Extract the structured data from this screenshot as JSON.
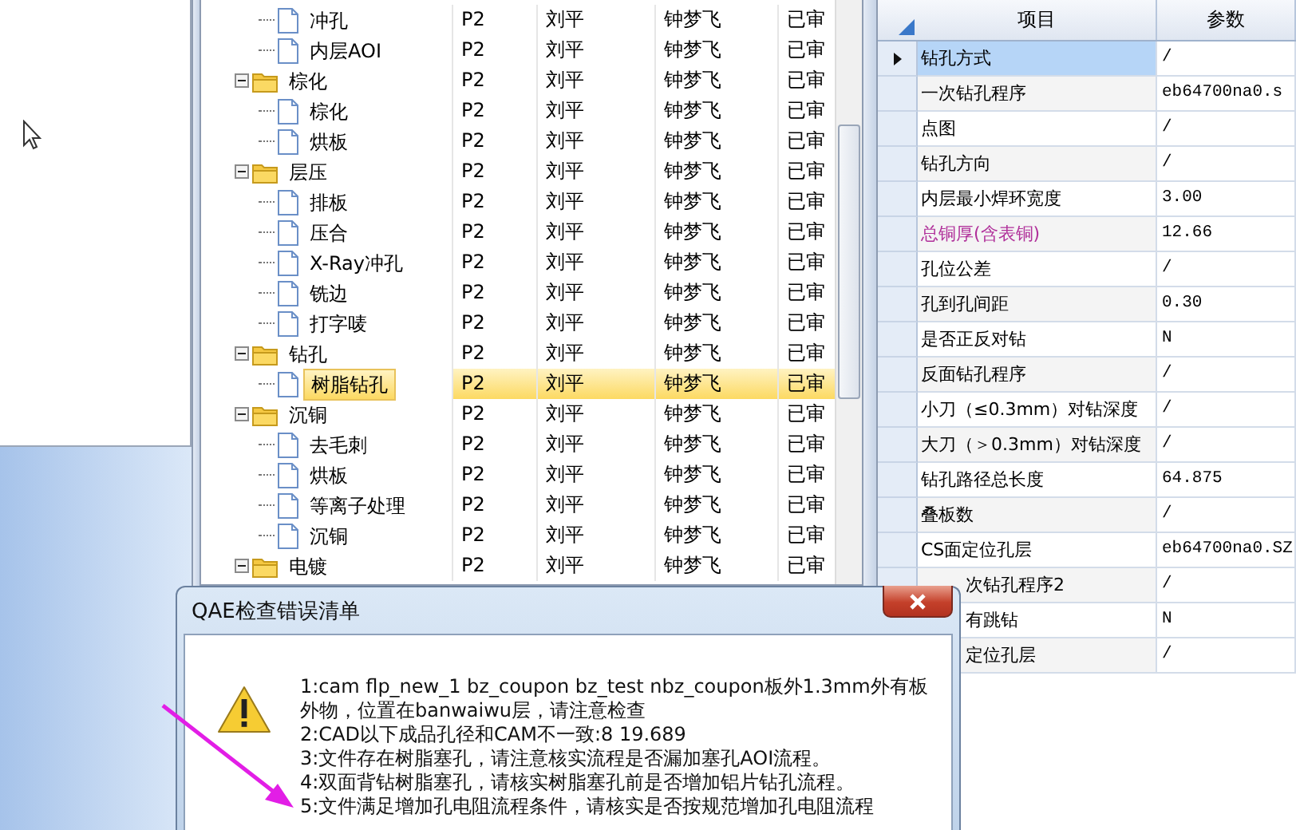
{
  "process_tree": {
    "items": [
      {
        "children": [
          {
            "kind": "file",
            "label": "冲孔",
            "selected": false,
            "cells": [
              "P2",
              "刘平",
              "钟梦飞",
              "已审"
            ]
          },
          {
            "kind": "file",
            "label": "内层AOI",
            "selected": false,
            "cells": [
              "P2",
              "刘平",
              "钟梦飞",
              "已审"
            ]
          }
        ]
      },
      {
        "kind": "folder",
        "label": "棕化",
        "expanded": true,
        "selected": false,
        "cells": [
          "P2",
          "刘平",
          "钟梦飞",
          "已审"
        ],
        "children": [
          {
            "kind": "file",
            "label": "棕化",
            "selected": false,
            "cells": [
              "P2",
              "刘平",
              "钟梦飞",
              "已审"
            ]
          },
          {
            "kind": "file",
            "label": "烘板",
            "selected": false,
            "cells": [
              "P2",
              "刘平",
              "钟梦飞",
              "已审"
            ]
          }
        ]
      },
      {
        "kind": "folder",
        "label": "层压",
        "expanded": true,
        "selected": false,
        "cells": [
          "P2",
          "刘平",
          "钟梦飞",
          "已审"
        ],
        "children": [
          {
            "kind": "file",
            "label": "排板",
            "selected": false,
            "cells": [
              "P2",
              "刘平",
              "钟梦飞",
              "已审"
            ]
          },
          {
            "kind": "file",
            "label": "压合",
            "selected": false,
            "cells": [
              "P2",
              "刘平",
              "钟梦飞",
              "已审"
            ]
          },
          {
            "kind": "file",
            "label": "X-Ray冲孔",
            "selected": false,
            "cells": [
              "P2",
              "刘平",
              "钟梦飞",
              "已审"
            ]
          },
          {
            "kind": "file",
            "label": "铣边",
            "selected": false,
            "cells": [
              "P2",
              "刘平",
              "钟梦飞",
              "已审"
            ]
          },
          {
            "kind": "file",
            "label": "打字唛",
            "selected": false,
            "cells": [
              "P2",
              "刘平",
              "钟梦飞",
              "已审"
            ]
          }
        ]
      },
      {
        "kind": "folder",
        "label": "钻孔",
        "expanded": true,
        "selected": false,
        "cells": [
          "P2",
          "刘平",
          "钟梦飞",
          "已审"
        ],
        "children": [
          {
            "kind": "file",
            "label": "树脂钻孔",
            "selected": true,
            "cells": [
              "P2",
              "刘平",
              "钟梦飞",
              "已审"
            ]
          }
        ]
      },
      {
        "kind": "folder",
        "label": "沉铜",
        "expanded": true,
        "selected": false,
        "cells": [
          "P2",
          "刘平",
          "钟梦飞",
          "已审"
        ],
        "children": [
          {
            "kind": "file",
            "label": "去毛刺",
            "selected": false,
            "cells": [
              "P2",
              "刘平",
              "钟梦飞",
              "已审"
            ]
          },
          {
            "kind": "file",
            "label": "烘板",
            "selected": false,
            "cells": [
              "P2",
              "刘平",
              "钟梦飞",
              "已审"
            ]
          },
          {
            "kind": "file",
            "label": "等离子处理",
            "selected": false,
            "cells": [
              "P2",
              "刘平",
              "钟梦飞",
              "已审"
            ]
          },
          {
            "kind": "file",
            "label": "沉铜",
            "selected": false,
            "cells": [
              "P2",
              "刘平",
              "钟梦飞",
              "已审"
            ]
          }
        ]
      },
      {
        "kind": "folder",
        "label": "电镀",
        "expanded": true,
        "selected": false,
        "cells": [
          "P2",
          "刘平",
          "钟梦飞",
          "已审"
        ]
      }
    ]
  },
  "property_grid": {
    "columns": [
      "项目",
      "参数"
    ],
    "rows": [
      {
        "item": "钻孔方式",
        "value": "/",
        "selected": true,
        "color": "#000000"
      },
      {
        "item": "一次钻孔程序",
        "value": "eb64700na0.s",
        "selected": false,
        "color": "#000000"
      },
      {
        "item": "点图",
        "value": "/",
        "selected": false,
        "color": "#000000"
      },
      {
        "item": "钻孔方向",
        "value": "/",
        "selected": false,
        "color": "#000000"
      },
      {
        "item": "内层最小焊环宽度",
        "value": "3.00",
        "selected": false,
        "color": "#000000"
      },
      {
        "item": "总铜厚(含表铜)",
        "value": "12.66",
        "selected": false,
        "color": "#b0309a"
      },
      {
        "item": "孔位公差",
        "value": "/",
        "selected": false,
        "color": "#000000"
      },
      {
        "item": "孔到孔间距",
        "value": "0.30",
        "selected": false,
        "color": "#000000"
      },
      {
        "item": "是否正反对钻",
        "value": "N",
        "selected": false,
        "color": "#000000"
      },
      {
        "item": "反面钻孔程序",
        "value": "/",
        "selected": false,
        "color": "#000000"
      },
      {
        "item": "小刀（≤0.3mm）对钻深度",
        "value": "/",
        "selected": false,
        "color": "#000000"
      },
      {
        "item": "大刀（＞0.3mm）对钻深度",
        "value": "/",
        "selected": false,
        "color": "#000000"
      },
      {
        "item": "钻孔路径总长度",
        "value": "64.875",
        "selected": false,
        "color": "#000000"
      },
      {
        "item": "叠板数",
        "value": "/",
        "selected": false,
        "color": "#000000"
      },
      {
        "item": "CS面定位孔层",
        "value": "eb64700na0.SZ",
        "selected": false,
        "color": "#000000"
      },
      {
        "item": "次钻孔程序2",
        "value": "/",
        "selected": false,
        "color": "#000000"
      },
      {
        "item": "有跳钻",
        "value": "N",
        "selected": false,
        "color": "#000000"
      },
      {
        "item": "定位孔层",
        "value": "/",
        "selected": false,
        "color": "#000000"
      }
    ]
  },
  "dialog": {
    "title": "QAE检查错误清单",
    "messages": [
      "1:cam flp_new_1 bz_coupon bz_test nbz_coupon板外1.3mm外有板外物，位置在banwaiwu层，请注意检查",
      "2:CAD以下成品孔径和CAM不一致:8 19.689",
      "3:文件存在树脂塞孔，请注意核实流程是否漏加塞孔AOI流程。",
      "4:双面背钻树脂塞孔，请核实树脂塞孔前是否增加铝片钻孔流程。",
      "5:文件满足增加孔电阻流程条件，请核实是否按规范增加孔电阻流程"
    ]
  }
}
